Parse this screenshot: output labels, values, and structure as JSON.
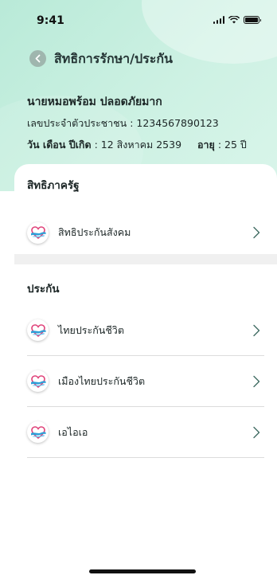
{
  "status_bar": {
    "time": "9:41"
  },
  "header": {
    "title": "สิทธิการรักษา/ประกัน",
    "person_name": "นายหมอพร้อม ปลอดภัยมาก",
    "id_label": "เลขประจำตัวประชาชน",
    "id_value": " : 1234567890123",
    "dob_label": "วัน เดือน ปีเกิด",
    "dob_value": " : 12 สิงหาคม 2539",
    "age_label": "อายุ",
    "age_value": " : 25 ปี"
  },
  "sections": {
    "government": {
      "title": "สิทธิภาครัฐ",
      "items": [
        {
          "label": "สิทธิประกันสังคม",
          "icon": "insurer-logo-icon"
        }
      ]
    },
    "insurance": {
      "title": "ประกัน",
      "items": [
        {
          "label": "ไทยประกันชีวิต",
          "icon": "insurer-logo-icon"
        },
        {
          "label": "เมืองไทยประกันชีวิต",
          "icon": "insurer-logo-icon"
        },
        {
          "label": "เอไอเอ",
          "icon": "insurer-logo-icon"
        }
      ]
    }
  },
  "colors": {
    "header_bg": "#c4eedd",
    "back_button": "#9fb6ae",
    "chevron": "#3f6b62",
    "divider": "#dcdcdc"
  }
}
